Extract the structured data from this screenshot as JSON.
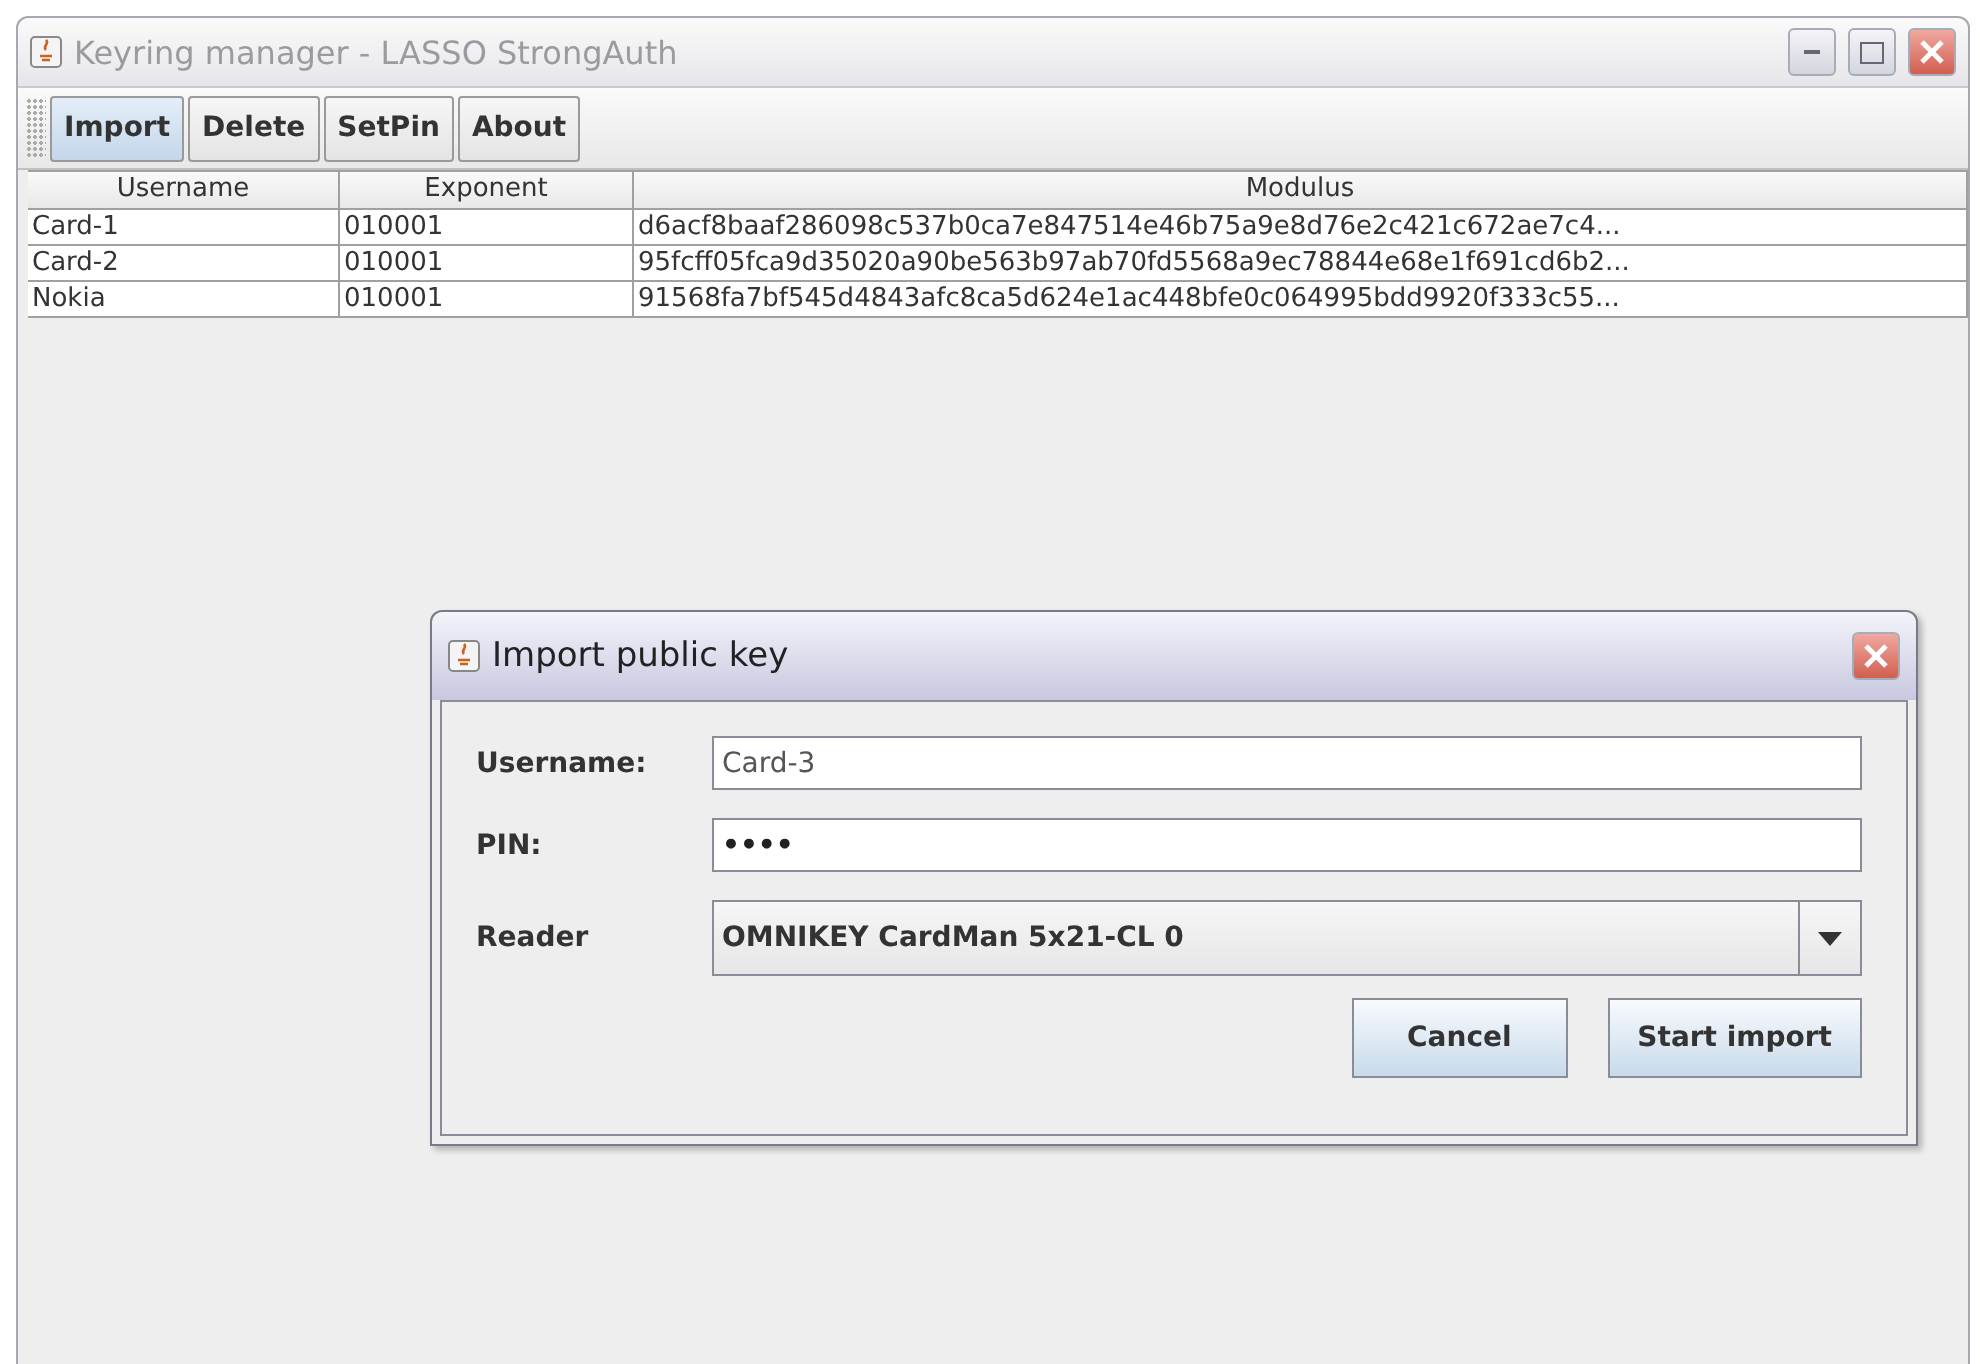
{
  "window": {
    "title": "Keyring manager - LASSO StrongAuth"
  },
  "toolbar": {
    "buttons": [
      {
        "label": "Import",
        "selected": true
      },
      {
        "label": "Delete",
        "selected": false
      },
      {
        "label": "SetPin",
        "selected": false
      },
      {
        "label": "About",
        "selected": false
      }
    ]
  },
  "table": {
    "columns": [
      "Username",
      "Exponent",
      "Modulus"
    ],
    "rows": [
      [
        "Card-1",
        "010001",
        "d6acf8baaf286098c537b0ca7e847514e46b75a9e8d76e2c421c672ae7c4..."
      ],
      [
        "Card-2",
        "010001",
        "95fcff05fca9d35020a90be563b97ab70fd5568a9ec78844e68e1f691cd6b2..."
      ],
      [
        "Nokia",
        "010001",
        "91568fa7bf545d4843afc8ca5d624e1ac448bfe0c064995bdd9920f333c55..."
      ]
    ]
  },
  "dialog": {
    "title": "Import public key",
    "fields": [
      {
        "kind": "text",
        "label": "Username:",
        "value": "Card-3"
      },
      {
        "kind": "password",
        "label": "PIN:",
        "value": "••••"
      },
      {
        "kind": "select",
        "label": "Reader",
        "value": "OMNIKEY CardMan 5x21-CL 0"
      }
    ],
    "buttons": [
      "Cancel",
      "Start import"
    ]
  }
}
